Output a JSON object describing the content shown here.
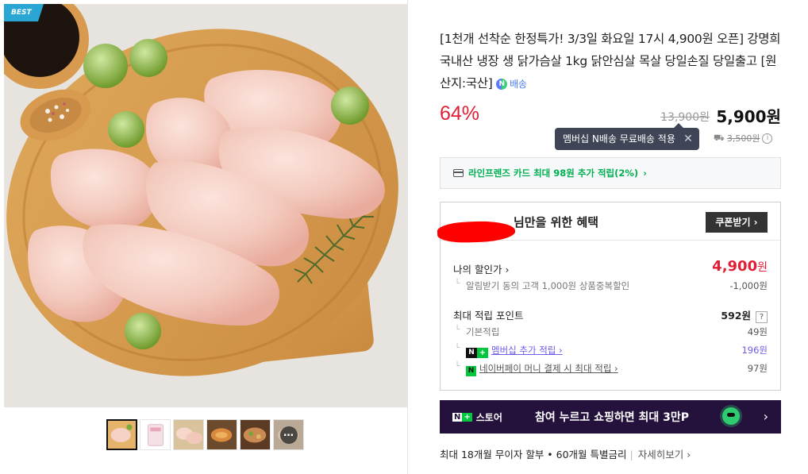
{
  "gallery": {
    "badge": "BEST",
    "thumbnails": [
      {
        "name": "thumb-chicken-board",
        "active": true
      },
      {
        "name": "thumb-package",
        "active": false
      },
      {
        "name": "thumb-chicken-closeup",
        "active": false
      },
      {
        "name": "thumb-grilled-chicken",
        "active": false
      },
      {
        "name": "thumb-cooked-dish",
        "active": false
      },
      {
        "name": "thumb-more",
        "active": false,
        "more_label": "…"
      }
    ]
  },
  "product": {
    "title": "[1천개 선착순 한정특가! 3/3일 화요일 17시 4,900원 오픈] 강명희 국내산 냉장 생 닭가슴살 1kg 닭안심살 목살 당일손질 당일출고 [원산지:국산]",
    "delivery_badge_icon": "N",
    "delivery_badge_label": "배송",
    "discount_rate": "64%",
    "original_price": "13,900원",
    "sale_price": "5,900원",
    "tooltip": "멤버십 N배송 무료배송 적용",
    "tooltip_close": "✕",
    "shipping_icon": "⛟",
    "shipping_fee": "3,500원",
    "info_icon": "i"
  },
  "card_banner": {
    "text": "라인프렌즈 카드 최대 98원 추가 적립(2%)",
    "arrow": "›"
  },
  "benefit": {
    "title_suffix": "님만을 위한 혜택",
    "coupon_button": "쿠폰받기 ›",
    "my_price_label": "나의 할인가 ›",
    "my_price_value": "4,900",
    "my_price_unit": "원",
    "my_price_sub_label": "알림받기 동의 고객 1,000원 상품중복할인",
    "my_price_sub_value": "-1,000원",
    "points_label": "최대 적립 포인트",
    "points_value": "592원",
    "points_help": "?",
    "basic_label": "기본적립",
    "basic_value": "49원",
    "membership_badge_n": "N",
    "membership_badge_plus": "+",
    "membership_label": "멤버십 추가 적립 ›",
    "membership_value": "196원",
    "npay_badge": "N",
    "npay_label": "네이버페이 머니 결제 시 최대 적립 ›",
    "npay_value": "97원"
  },
  "promo": {
    "logo_n": "N",
    "logo_plus": "+",
    "logo_text": "스토어",
    "text": "참여 누르고 쇼핑하면 최대 3만P",
    "arrow": "›"
  },
  "installment": {
    "text": "최대 18개월 무이자 할부 • 60개월 특별금리",
    "separator": "|",
    "more": "자세히보기 ›"
  },
  "colors": {
    "accent_red": "#e01f35",
    "naver_green": "#00c73c",
    "promo_bg": "#24123d",
    "tooltip_bg": "#3f4556",
    "badge_blue": "#2aa6d5",
    "membership_purple": "#6c5ce7"
  }
}
